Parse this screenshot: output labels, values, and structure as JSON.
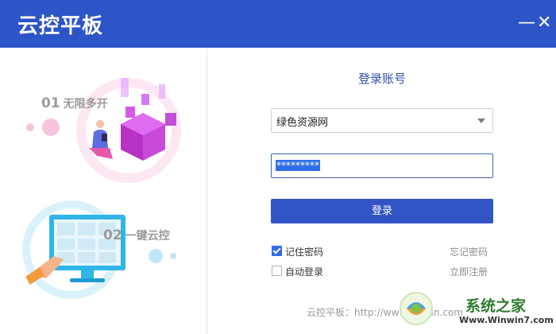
{
  "app": {
    "title": "云控平板"
  },
  "window_controls": {
    "minimize": "—",
    "close": "✕"
  },
  "features": [
    {
      "num": "01",
      "label": "无限多开"
    },
    {
      "num": "02",
      "label": "一键云控"
    }
  ],
  "login": {
    "title": "登录账号",
    "account_value": "绿色资源网",
    "password_mask": "*********",
    "submit_label": "登录",
    "remember_label": "记住密码",
    "remember_checked": true,
    "autologin_label": "自动登录",
    "autologin_checked": false,
    "forgot_label": "忘记密码",
    "register_label": "立即注册"
  },
  "footer": {
    "text": "云控平板：http://www.yiksan.com"
  },
  "watermark": {
    "brand": "系统之家",
    "url": "Www.Winwin7.com"
  },
  "colors": {
    "brand_blue": "#2e55c8",
    "button_blue": "#3354c4",
    "illustration_pink": "#e84aa8",
    "illustration_cyan": "#2fb5e8"
  }
}
